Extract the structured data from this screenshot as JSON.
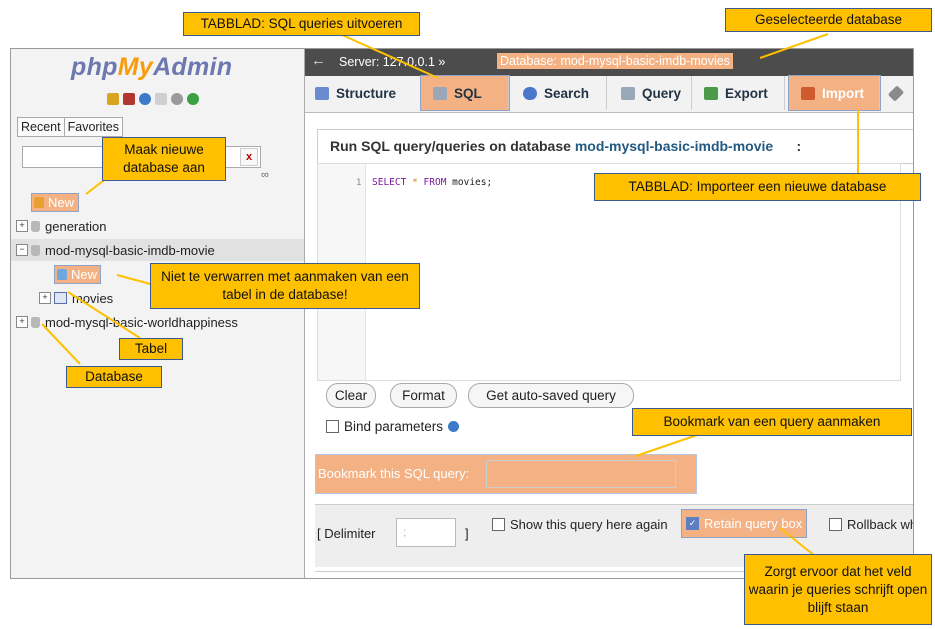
{
  "app": {
    "logo_php": "php",
    "logo_my": "My",
    "logo_admin": "Admin"
  },
  "sidebar": {
    "tabs": [
      "Recent",
      "Favorites"
    ],
    "filter_clear": "x",
    "link_icon": "∞",
    "new_label": "New",
    "items": [
      {
        "label": "generation"
      },
      {
        "label": "mod-mysql-basic-imdb-movie"
      },
      {
        "label": "New"
      },
      {
        "label": "movies"
      },
      {
        "label": "mod-mysql-basic-worldhappiness"
      }
    ],
    "expand_plus": "+",
    "expand_minus": "−"
  },
  "topbar": {
    "back": "←",
    "server": "Server: 127.0.0.1 »",
    "database": "Database: mod-mysql-basic-imdb-movies"
  },
  "tabs": [
    {
      "label": "Structure",
      "icon": "structure-icon",
      "color": "#6a8bd0"
    },
    {
      "label": "SQL",
      "icon": "sql-icon",
      "color": "#9aa7b8"
    },
    {
      "label": "Search",
      "icon": "search-icon",
      "color": "#4a78c8"
    },
    {
      "label": "Query",
      "icon": "query-icon",
      "color": "#9aa7b8"
    },
    {
      "label": "Export",
      "icon": "export-icon",
      "color": "#4a9a4a"
    },
    {
      "label": "Import",
      "icon": "import-icon",
      "color": "#d05a30"
    }
  ],
  "panel": {
    "title": "Run SQL query/queries on database ",
    "db": "mod-mysql-basic-imdb-movie",
    "colon": ":"
  },
  "editor": {
    "line": "1",
    "kw1": "SELECT",
    "op": "*",
    "kw2": "FROM",
    "rest": "movies;"
  },
  "buttons": {
    "clear": "Clear",
    "format": "Format",
    "autosaved": "Get auto-saved query"
  },
  "bind_parameters": "Bind parameters",
  "bookmark_label": "Bookmark this SQL query:",
  "footer": {
    "delimiter": "[ Delimiter",
    "delimiter_value": ";",
    "bracket": "]",
    "show_again": "Show this query here again",
    "retain": "Retain query box",
    "rollback": "Rollback wh"
  },
  "callouts": {
    "sql_tab": "TABBLAD: SQL queries uitvoeren",
    "selected_db": "Geselecteerde database",
    "new_db": "Maak nieuwe database aan",
    "import_tab": "TABBLAD: Importeer een nieuwe database",
    "not_table": "Niet te verwarren met aanmaken van een tabel in de database!",
    "table": "Tabel",
    "database": "Database",
    "bookmark": "Bookmark van een query aanmaken",
    "retain": "Zorgt ervoor dat het veld waarin je queries schrijft open blijft staan"
  },
  "colors": {
    "callout": "#ffc000",
    "highlight": "#f4b183",
    "callout_border": "#3a5a90"
  }
}
